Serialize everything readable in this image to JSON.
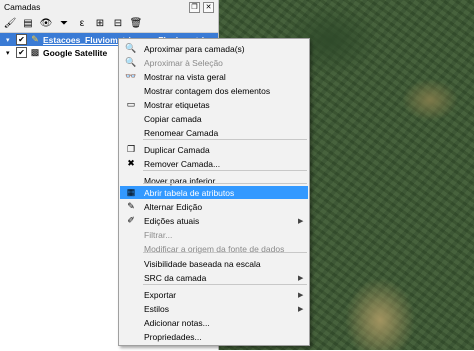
{
  "panel": {
    "title": "Camadas",
    "layers": [
      {
        "name": "Estacoes_Fluviometricas — Fluviometrica",
        "checked": true,
        "selected": true
      },
      {
        "name": "Google Satellite",
        "checked": true,
        "selected": false
      }
    ]
  },
  "menu": {
    "items": [
      {
        "label": "Aproximar para camada(s)",
        "icon": "zoom-icon",
        "glyph": "🔍"
      },
      {
        "label": "Aproximar à Seleção",
        "icon": "zoom-selection-icon",
        "glyph": "🔍",
        "disabled": true
      },
      {
        "label": "Mostrar na vista geral",
        "icon": "overview-icon",
        "glyph": "👓"
      },
      {
        "label": "Mostrar contagem dos elementos",
        "icon": "",
        "glyph": ""
      },
      {
        "label": "Mostrar etiquetas",
        "icon": "labels-icon",
        "glyph": "▭"
      },
      {
        "label": "Copiar camada",
        "icon": "",
        "glyph": ""
      },
      {
        "label": "Renomear Camada",
        "icon": "",
        "glyph": ""
      },
      {
        "label": "Duplicar Camada",
        "icon": "duplicate-icon",
        "glyph": "❐"
      },
      {
        "label": "Remover Camada...",
        "icon": "remove-icon",
        "glyph": "✖"
      },
      {
        "label": "Mover para inferior",
        "icon": "",
        "glyph": ""
      },
      {
        "label": "Abrir tabela de atributos",
        "icon": "table-icon",
        "glyph": "▦",
        "highlight": true
      },
      {
        "label": "Alternar Edição",
        "icon": "pencil-icon",
        "glyph": "✎"
      },
      {
        "label": "Edições atuais",
        "icon": "edits-icon",
        "glyph": "✐",
        "submenu": true
      },
      {
        "label": "Filtrar...",
        "icon": "",
        "glyph": "",
        "disabled": true
      },
      {
        "label": "Modificar a origem da fonte de dados",
        "icon": "",
        "glyph": "",
        "disabled": true
      },
      {
        "label": "Visibilidade baseada na escala",
        "icon": "",
        "glyph": ""
      },
      {
        "label": "SRC da camada",
        "icon": "",
        "glyph": "",
        "submenu": true
      },
      {
        "label": "Exportar",
        "icon": "",
        "glyph": "",
        "submenu": true
      },
      {
        "label": "Estilos",
        "icon": "",
        "glyph": "",
        "submenu": true
      },
      {
        "label": "Adicionar notas...",
        "icon": "",
        "glyph": ""
      },
      {
        "label": "Propriedades...",
        "icon": "",
        "glyph": ""
      }
    ]
  }
}
